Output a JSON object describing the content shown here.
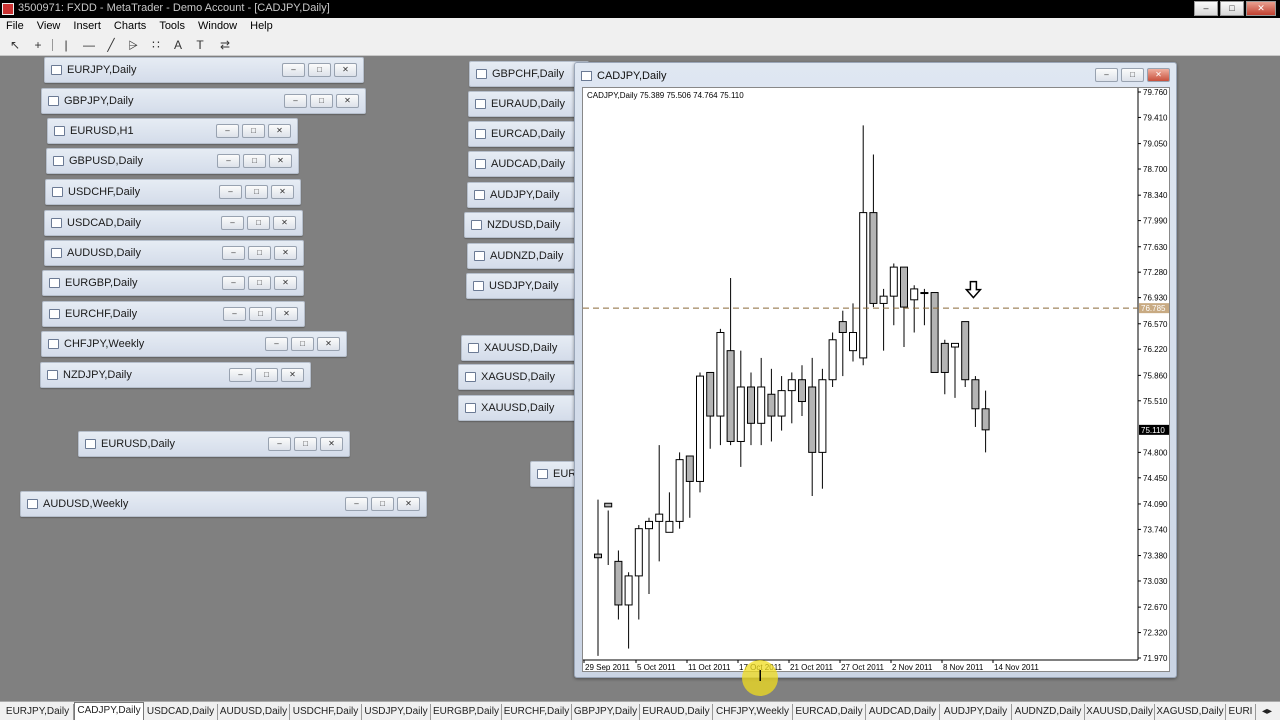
{
  "app": {
    "title": "3500971: FXDD - MetaTrader - Demo Account - [CADJPY,Daily]",
    "window_buttons": [
      "–",
      "□",
      "✕"
    ]
  },
  "menu": [
    "File",
    "View",
    "Insert",
    "Charts",
    "Tools",
    "Window",
    "Help"
  ],
  "toolbar": {
    "icons": [
      "arrow-cursor-icon",
      "crosshair-icon",
      "vertical-line-icon",
      "horizontal-line-icon",
      "trendline-icon",
      "equidistant-channel-icon",
      "fibonacci-icon",
      "text-icon",
      "text-label-icon",
      "arrows-icon"
    ],
    "glyphs": [
      "↖",
      "+",
      "|",
      "—",
      "╱",
      "⩥",
      "∷",
      "A",
      "T",
      "⇄"
    ]
  },
  "mini_windows": {
    "left": [
      "EURJPY,Daily",
      "GBPJPY,Daily",
      "EURUSD,H1",
      "GBPUSD,Daily",
      "USDCHF,Daily",
      "USDCAD,Daily",
      "AUDUSD,Daily",
      "EURGBP,Daily",
      "EURCHF,Daily",
      "CHFJPY,Weekly",
      "NZDJPY,Daily",
      "EURUSD,Daily",
      "AUDUSD,Weekly"
    ],
    "middle": [
      "GBPCHF,Daily",
      "EURAUD,Daily",
      "EURCAD,Daily",
      "AUDCAD,Daily",
      "AUDJPY,Daily",
      "NZDUSD,Daily",
      "AUDNZD,Daily",
      "USDJPY,Daily",
      "XAUUSD,Daily",
      "XAGUSD,Daily",
      "XAUUSD,Daily",
      "EURU"
    ],
    "btn_labels": [
      "–",
      "□",
      "✕"
    ]
  },
  "chart_window": {
    "title": "CADJPY,Daily",
    "info": "CADJPY,Daily  75.389 75.506 74.764 75.110"
  },
  "chart_data": {
    "type": "candlestick",
    "symbol": "CADJPY",
    "timeframe": "Daily",
    "ohlc_header": {
      "open": 75.389,
      "high": 75.506,
      "low": 74.764,
      "close": 75.11
    },
    "y_ticks": [
      "79.760",
      "79.410",
      "79.050",
      "78.700",
      "78.340",
      "77.990",
      "77.630",
      "77.280",
      "76.930",
      "76.570",
      "76.220",
      "75.860",
      "75.510",
      "74.800",
      "74.450",
      "74.090",
      "73.740",
      "73.380",
      "73.030",
      "72.670",
      "72.320",
      "71.970"
    ],
    "ylim": [
      71.97,
      79.76
    ],
    "x_ticks": [
      "29 Sep 2011",
      "5 Oct 2011",
      "11 Oct 2011",
      "17 Oct 2011",
      "21 Oct 2011",
      "27 Oct 2011",
      "2 Nov 2011",
      "8 Nov 2011",
      "14 Nov 2011"
    ],
    "marked_level": "76.785",
    "current_price": "75.110",
    "candles": [
      [
        73.4,
        74.15,
        72.0,
        73.35
      ],
      [
        74.1,
        74.0,
        73.25,
        74.05
      ],
      [
        73.3,
        73.45,
        72.5,
        72.7
      ],
      [
        72.7,
        73.15,
        72.1,
        73.1
      ],
      [
        73.1,
        73.8,
        72.5,
        73.75
      ],
      [
        73.75,
        73.9,
        72.85,
        73.85
      ],
      [
        73.85,
        74.9,
        73.3,
        73.95
      ],
      [
        73.7,
        74.25,
        73.7,
        73.85
      ],
      [
        73.85,
        74.8,
        73.75,
        74.7
      ],
      [
        74.75,
        74.55,
        73.9,
        74.4
      ],
      [
        74.4,
        75.9,
        74.25,
        75.85
      ],
      [
        75.9,
        75.7,
        74.85,
        75.3
      ],
      [
        75.3,
        76.5,
        74.9,
        76.45
      ],
      [
        76.2,
        77.2,
        74.9,
        74.95
      ],
      [
        74.95,
        76.2,
        74.6,
        75.7
      ],
      [
        75.7,
        75.9,
        74.9,
        75.2
      ],
      [
        75.2,
        76.1,
        74.9,
        75.7
      ],
      [
        75.6,
        75.95,
        74.95,
        75.3
      ],
      [
        75.3,
        75.85,
        75.1,
        75.65
      ],
      [
        75.65,
        75.9,
        75.2,
        75.8
      ],
      [
        75.8,
        76.0,
        75.3,
        75.5
      ],
      [
        75.7,
        76.1,
        74.2,
        74.8
      ],
      [
        74.8,
        75.95,
        74.3,
        75.8
      ],
      [
        75.8,
        76.45,
        75.7,
        76.35
      ],
      [
        76.6,
        76.75,
        75.85,
        76.45
      ],
      [
        76.2,
        76.85,
        76.05,
        76.45
      ],
      [
        76.1,
        79.3,
        76.0,
        78.1
      ],
      [
        78.1,
        78.9,
        76.8,
        76.85
      ],
      [
        76.85,
        77.05,
        76.2,
        76.95
      ],
      [
        76.95,
        77.4,
        76.55,
        77.35
      ],
      [
        77.35,
        77.35,
        76.25,
        76.8
      ],
      [
        76.9,
        77.1,
        76.45,
        77.05
      ],
      [
        77.0,
        77.05,
        76.55,
        77.0
      ],
      [
        77.0,
        77.0,
        75.9,
        75.9
      ],
      [
        76.3,
        76.35,
        75.6,
        75.9
      ],
      [
        76.25,
        76.3,
        75.55,
        76.3
      ],
      [
        76.6,
        76.6,
        75.7,
        75.8
      ],
      [
        75.8,
        75.85,
        75.15,
        75.4
      ],
      [
        75.4,
        75.65,
        74.8,
        75.11
      ]
    ]
  },
  "tabs": [
    "EURJPY,Daily",
    "CADJPY,Daily",
    "USDCAD,Daily",
    "AUDUSD,Daily",
    "USDCHF,Daily",
    "USDJPY,Daily",
    "EURGBP,Daily",
    "EURCHF,Daily",
    "GBPJPY,Daily",
    "EURAUD,Daily",
    "CHFJPY,Weekly",
    "EURCAD,Daily",
    "AUDCAD,Daily",
    "AUDJPY,Daily",
    "AUDNZD,Daily",
    "XAUUSD,Daily",
    "XAGUSD,Daily",
    "EURI"
  ],
  "active_tab": "CADJPY,Daily",
  "colors": {
    "background": "#808080",
    "bull_candle": "#ffffff",
    "bear_candle": "#b4b4b4",
    "level_line": "#8a6a3a"
  }
}
